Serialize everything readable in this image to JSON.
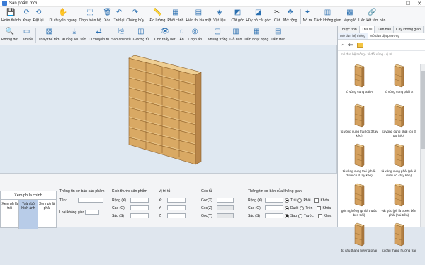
{
  "window": {
    "title": "Sản phẩm mới",
    "controls": [
      "—",
      "☐",
      "✕"
    ]
  },
  "toolbar_main": [
    {
      "id": "finish",
      "label": "Hoàn thành",
      "icon": "💾",
      "color": "#2a6fb0"
    },
    {
      "id": "rotate",
      "label": "Xoay",
      "icon": "⟳",
      "color": "#2a6fb0"
    },
    {
      "id": "reset",
      "label": "Đặt lại",
      "icon": "⟲",
      "color": "#2a6fb0"
    },
    {
      "id": "pan",
      "label": "Di chuyển ngang",
      "icon": "✋",
      "color": "#444"
    },
    {
      "id": "select-all",
      "label": "Chọn toàn bộ",
      "icon": "⬚",
      "color": "#2a6fb0"
    },
    {
      "id": "delete",
      "label": "Xóa",
      "icon": "🗑",
      "color": "#2a6fb0"
    },
    {
      "id": "undo",
      "label": "Trở lại",
      "icon": "↶",
      "color": "#2a6fb0"
    },
    {
      "id": "redo",
      "label": "Chống hủy",
      "icon": "↷",
      "color": "#2a6fb0"
    },
    {
      "id": "measure",
      "label": "Đo lường",
      "icon": "📏",
      "color": "#2a6fb0"
    },
    {
      "id": "split",
      "label": "Phối cảnh",
      "icon": "▦",
      "color": "#2a6fb0"
    },
    {
      "id": "show-all",
      "label": "Hiển thị kia mặt",
      "icon": "▤",
      "color": "#2a6fb0"
    },
    {
      "id": "material",
      "label": "Vật liệu",
      "icon": "◈",
      "color": "#2a6fb0"
    },
    {
      "id": "cut-corner",
      "label": "Cắt góc",
      "icon": "◩",
      "color": "#2a6fb0"
    },
    {
      "id": "cancel-cut",
      "label": "Hủy bỏ cắt góc",
      "icon": "◪",
      "color": "#2a6fb0"
    },
    {
      "id": "cut",
      "label": "Cắt",
      "icon": "✂",
      "color": "#444"
    },
    {
      "id": "open-hole",
      "label": "Mở rộng",
      "icon": "✥",
      "color": "#2a6fb0"
    },
    {
      "id": "enlarge",
      "label": "Nổ ra",
      "icon": "✦",
      "color": "#2a6fb0"
    },
    {
      "id": "separate",
      "label": "Tách không gian",
      "icon": "▥",
      "color": "#2a6fb0"
    },
    {
      "id": "mesh",
      "label": "Mạng lỗ",
      "icon": "▩",
      "color": "#2a6fb0"
    },
    {
      "id": "link",
      "label": "Liên kết tấm bản",
      "icon": "🔗",
      "color": "#2a6fb0"
    }
  ],
  "toolbar_secondary": [
    {
      "id": "room",
      "label": "Phòng đợi",
      "icon": "🔍"
    },
    {
      "id": "remake",
      "label": "Làm bề",
      "icon": "▭"
    },
    {
      "id": "replace-panel",
      "label": "Thay thế tấm",
      "icon": "▧"
    },
    {
      "id": "lower-panel",
      "label": "Xuống liệu tấm",
      "icon": "⤓"
    },
    {
      "id": "move",
      "label": "Di chuyển tủ",
      "icon": "⇄"
    },
    {
      "id": "copy",
      "label": "Sao chép tủ",
      "icon": "⎘"
    },
    {
      "id": "mirror",
      "label": "Gương tủ",
      "icon": "◫"
    },
    {
      "id": "show-all2",
      "label": "Cho thấy hết",
      "icon": "👁"
    },
    {
      "id": "hide",
      "label": "Ẩn",
      "icon": "◌"
    },
    {
      "id": "select-hide",
      "label": "Chọn ẩn",
      "icon": "◎"
    },
    {
      "id": "frame-space",
      "label": "Khung trống",
      "icon": "▢"
    },
    {
      "id": "wood-edge",
      "label": "Gỗ đán",
      "icon": "▥"
    },
    {
      "id": "activity-panel",
      "label": "Tấm hoạt động",
      "icon": "▦"
    },
    {
      "id": "top-panel",
      "label": "Tấm trên",
      "icon": "▤"
    }
  ],
  "bottom_panel": {
    "view_tabs": {
      "header": "Xem ph la chính",
      "tabs": [
        "Xem ph là trái",
        "Toàn bộ hình ảnh",
        "Xem ph là phải"
      ],
      "active": 1
    },
    "basic_info": {
      "title": "Thông tin cơ bản sản phẩm",
      "name_label": "Tên:",
      "type_label": "Loại không gian"
    },
    "size": {
      "title": "Kích thước sản phẩm",
      "width": "Rộng (X)",
      "height": "Cao (G)",
      "depth": "Sâu (S)"
    },
    "position": {
      "title": "Vị trí tủ",
      "x": "X:",
      "y": "Y:",
      "z": "Z:"
    },
    "angle": {
      "title": "Góc tủ",
      "x": "Góc(X)",
      "z": "Góc(Z)",
      "y": "Góc(Y)"
    },
    "space": {
      "title": "Thông tin cơ bản của không gian",
      "width": "Rộng (X)",
      "height": "Cao (G)",
      "depth": "Sâu (S)",
      "rows": [
        {
          "opt1": "Trái",
          "opt2": "Phải",
          "chk": "Khóa"
        },
        {
          "opt1": "Dưới",
          "opt2": "Trên",
          "chk": "Khóa"
        },
        {
          "opt1": "Sau",
          "opt2": "Trước",
          "chk": "Khóa"
        }
      ]
    }
  },
  "right_panel": {
    "tabs": [
      "Thuộc tính",
      "Thư tù",
      "Tâm bàn",
      "Cây không gian"
    ],
    "active_tab": 1,
    "subtabs": [
      "Mô đun hệ thống",
      "Mô đun địa phương"
    ],
    "active_subtab": 0,
    "path": "mô đun hệ thống · vĩ đối xứng · vị trí",
    "items": [
      {
        "caption": "tủ vòng cung trái A"
      },
      {
        "caption": "tủ vòng cung phải A"
      },
      {
        "caption": "tủ vòng cung trái (có 3 tay kéo)"
      },
      {
        "caption": "tủ vòng cung phải (có 3 tay kéo)"
      },
      {
        "caption": "tủ vòng cung trái (ph là dưới có 4 tay kéo)"
      },
      {
        "caption": "tủ vòng cung phải (ph là dưới có 4tay kéo)"
      },
      {
        "caption": "góc nghiêng (ph là trước bên trái)"
      },
      {
        "caption": "vát góc (ph là trước bên phải (hai trên)"
      },
      {
        "caption": "tủ cầu thang hướng phải"
      },
      {
        "caption": "tủ cầu thang hướng trái"
      }
    ]
  }
}
